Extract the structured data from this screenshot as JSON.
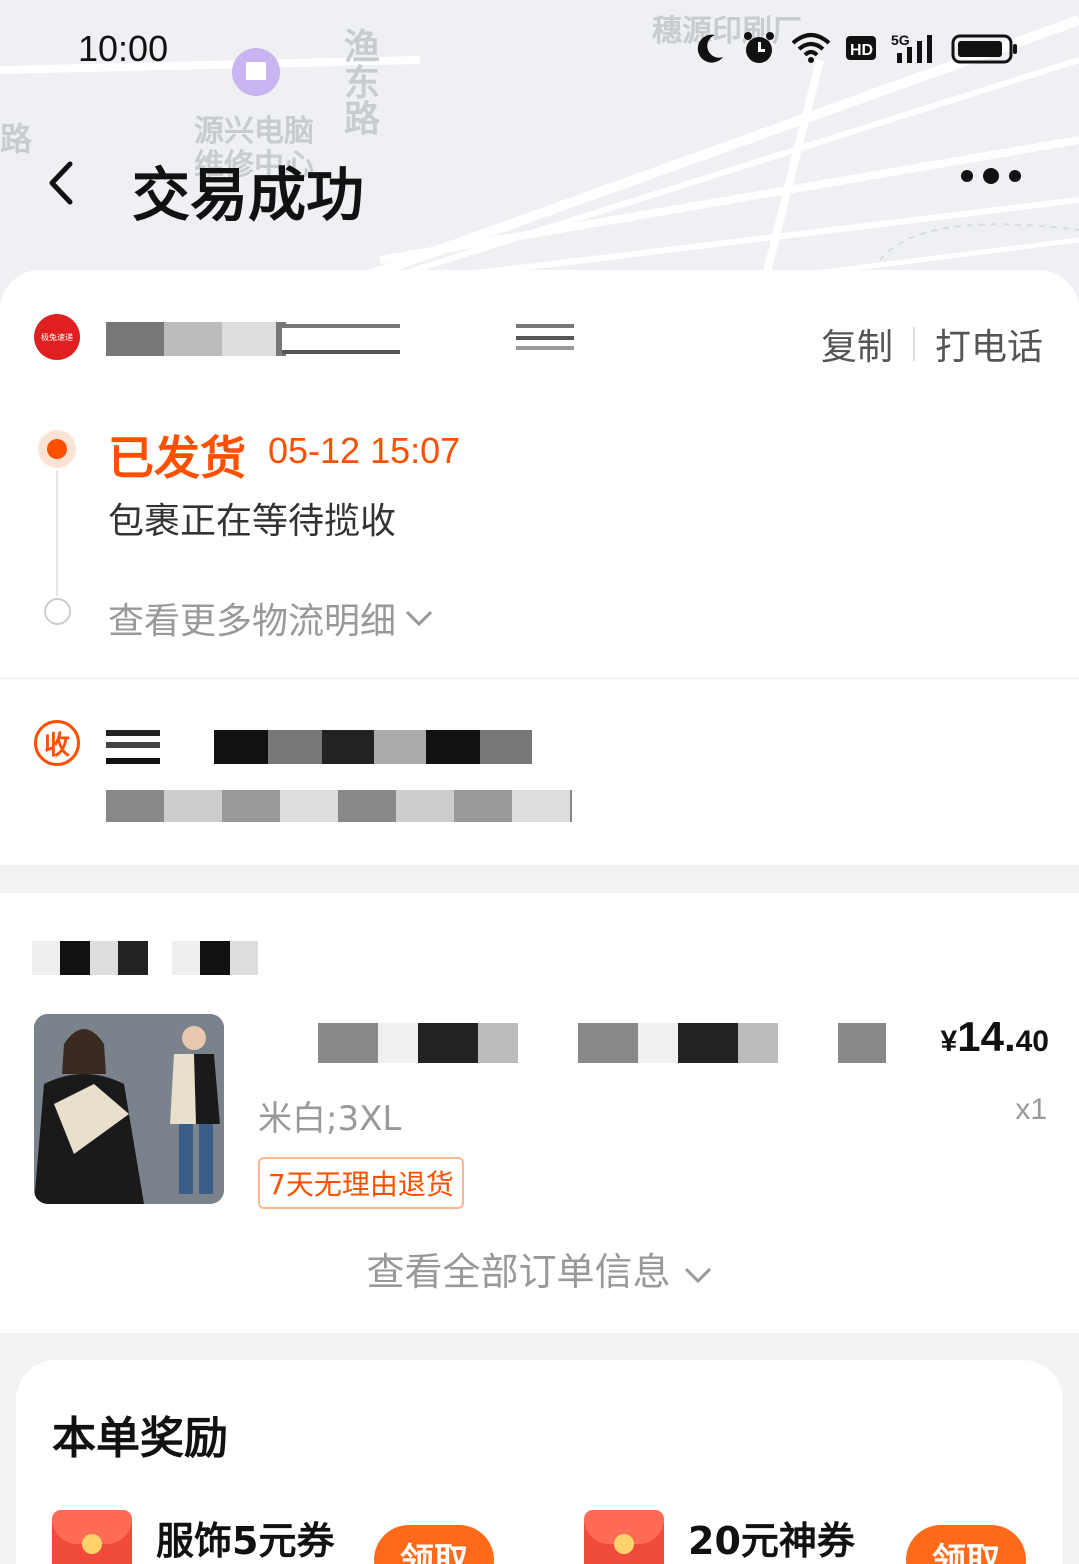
{
  "status_bar": {
    "time": "10:00",
    "icons": [
      "moon-icon",
      "alarm-icon",
      "wifi-icon",
      "hd-icon",
      "signal-5g-icon",
      "battery-icon"
    ]
  },
  "map": {
    "labels": [
      "路",
      "源兴电脑",
      "维修中心",
      "渔东路",
      "穗源印刷厂"
    ]
  },
  "nav": {
    "title": "交易成功",
    "back_icon": "chevron-left-icon",
    "more_icon": "more-dots-icon"
  },
  "courier": {
    "logo_text": "极兔速递",
    "copy_label": "复制",
    "call_label": "打电话"
  },
  "logistics": {
    "status": "已发货",
    "time": "05-12 15:07",
    "desc": "包裹正在等待揽收",
    "more_label": "查看更多物流明细"
  },
  "receiver": {
    "icon_text": "收"
  },
  "product": {
    "price_symbol": "¥",
    "price_int": "14.",
    "price_dec": "40",
    "sku": "米白;3XL",
    "qty": "x1",
    "badge": "7天无理由退货",
    "view_all_label": "查看全部订单信息"
  },
  "reward": {
    "title": "本单奖励",
    "coupons": [
      {
        "label": "服饰5元券",
        "claim": "领取"
      },
      {
        "label": "20元神券",
        "claim": "领取"
      }
    ]
  },
  "colors": {
    "accent": "#ff5000",
    "claim_button": "#ff6a1a",
    "background": "#f2f2f2"
  }
}
